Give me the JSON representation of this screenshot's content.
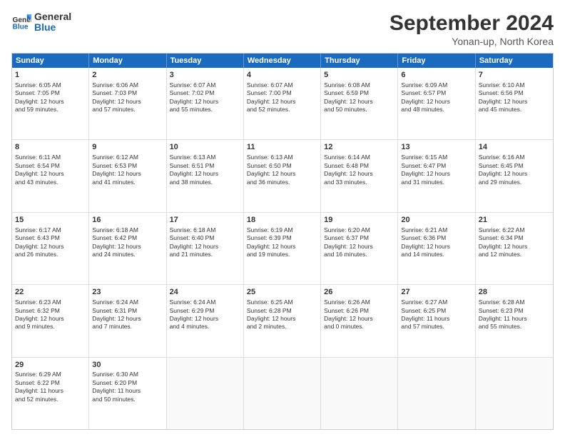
{
  "header": {
    "logo_line1": "General",
    "logo_line2": "Blue",
    "month": "September 2024",
    "location": "Yonan-up, North Korea"
  },
  "days": [
    "Sunday",
    "Monday",
    "Tuesday",
    "Wednesday",
    "Thursday",
    "Friday",
    "Saturday"
  ],
  "rows": [
    [
      {
        "num": "",
        "data": ""
      },
      {
        "num": "2",
        "data": "Sunrise: 6:06 AM\nSunset: 7:03 PM\nDaylight: 12 hours\nand 57 minutes."
      },
      {
        "num": "3",
        "data": "Sunrise: 6:07 AM\nSunset: 7:02 PM\nDaylight: 12 hours\nand 55 minutes."
      },
      {
        "num": "4",
        "data": "Sunrise: 6:07 AM\nSunset: 7:00 PM\nDaylight: 12 hours\nand 52 minutes."
      },
      {
        "num": "5",
        "data": "Sunrise: 6:08 AM\nSunset: 6:59 PM\nDaylight: 12 hours\nand 50 minutes."
      },
      {
        "num": "6",
        "data": "Sunrise: 6:09 AM\nSunset: 6:57 PM\nDaylight: 12 hours\nand 48 minutes."
      },
      {
        "num": "7",
        "data": "Sunrise: 6:10 AM\nSunset: 6:56 PM\nDaylight: 12 hours\nand 45 minutes."
      }
    ],
    [
      {
        "num": "1",
        "data": "Sunrise: 6:05 AM\nSunset: 7:05 PM\nDaylight: 12 hours\nand 59 minutes.",
        "first": true
      }
    ],
    [
      {
        "num": "8",
        "data": "Sunrise: 6:11 AM\nSunset: 6:54 PM\nDaylight: 12 hours\nand 43 minutes."
      },
      {
        "num": "9",
        "data": "Sunrise: 6:12 AM\nSunset: 6:53 PM\nDaylight: 12 hours\nand 41 minutes."
      },
      {
        "num": "10",
        "data": "Sunrise: 6:13 AM\nSunset: 6:51 PM\nDaylight: 12 hours\nand 38 minutes."
      },
      {
        "num": "11",
        "data": "Sunrise: 6:13 AM\nSunset: 6:50 PM\nDaylight: 12 hours\nand 36 minutes."
      },
      {
        "num": "12",
        "data": "Sunrise: 6:14 AM\nSunset: 6:48 PM\nDaylight: 12 hours\nand 33 minutes."
      },
      {
        "num": "13",
        "data": "Sunrise: 6:15 AM\nSunset: 6:47 PM\nDaylight: 12 hours\nand 31 minutes."
      },
      {
        "num": "14",
        "data": "Sunrise: 6:16 AM\nSunset: 6:45 PM\nDaylight: 12 hours\nand 29 minutes."
      }
    ],
    [
      {
        "num": "15",
        "data": "Sunrise: 6:17 AM\nSunset: 6:43 PM\nDaylight: 12 hours\nand 26 minutes."
      },
      {
        "num": "16",
        "data": "Sunrise: 6:18 AM\nSunset: 6:42 PM\nDaylight: 12 hours\nand 24 minutes."
      },
      {
        "num": "17",
        "data": "Sunrise: 6:18 AM\nSunset: 6:40 PM\nDaylight: 12 hours\nand 21 minutes."
      },
      {
        "num": "18",
        "data": "Sunrise: 6:19 AM\nSunset: 6:39 PM\nDaylight: 12 hours\nand 19 minutes."
      },
      {
        "num": "19",
        "data": "Sunrise: 6:20 AM\nSunset: 6:37 PM\nDaylight: 12 hours\nand 16 minutes."
      },
      {
        "num": "20",
        "data": "Sunrise: 6:21 AM\nSunset: 6:36 PM\nDaylight: 12 hours\nand 14 minutes."
      },
      {
        "num": "21",
        "data": "Sunrise: 6:22 AM\nSunset: 6:34 PM\nDaylight: 12 hours\nand 12 minutes."
      }
    ],
    [
      {
        "num": "22",
        "data": "Sunrise: 6:23 AM\nSunset: 6:32 PM\nDaylight: 12 hours\nand 9 minutes."
      },
      {
        "num": "23",
        "data": "Sunrise: 6:24 AM\nSunset: 6:31 PM\nDaylight: 12 hours\nand 7 minutes."
      },
      {
        "num": "24",
        "data": "Sunrise: 6:24 AM\nSunset: 6:29 PM\nDaylight: 12 hours\nand 4 minutes."
      },
      {
        "num": "25",
        "data": "Sunrise: 6:25 AM\nSunset: 6:28 PM\nDaylight: 12 hours\nand 2 minutes."
      },
      {
        "num": "26",
        "data": "Sunrise: 6:26 AM\nSunset: 6:26 PM\nDaylight: 12 hours\nand 0 minutes."
      },
      {
        "num": "27",
        "data": "Sunrise: 6:27 AM\nSunset: 6:25 PM\nDaylight: 11 hours\nand 57 minutes."
      },
      {
        "num": "28",
        "data": "Sunrise: 6:28 AM\nSunset: 6:23 PM\nDaylight: 11 hours\nand 55 minutes."
      }
    ],
    [
      {
        "num": "29",
        "data": "Sunrise: 6:29 AM\nSunset: 6:22 PM\nDaylight: 11 hours\nand 52 minutes."
      },
      {
        "num": "30",
        "data": "Sunrise: 6:30 AM\nSunset: 6:20 PM\nDaylight: 11 hours\nand 50 minutes."
      },
      {
        "num": "",
        "data": ""
      },
      {
        "num": "",
        "data": ""
      },
      {
        "num": "",
        "data": ""
      },
      {
        "num": "",
        "data": ""
      },
      {
        "num": "",
        "data": ""
      }
    ]
  ]
}
